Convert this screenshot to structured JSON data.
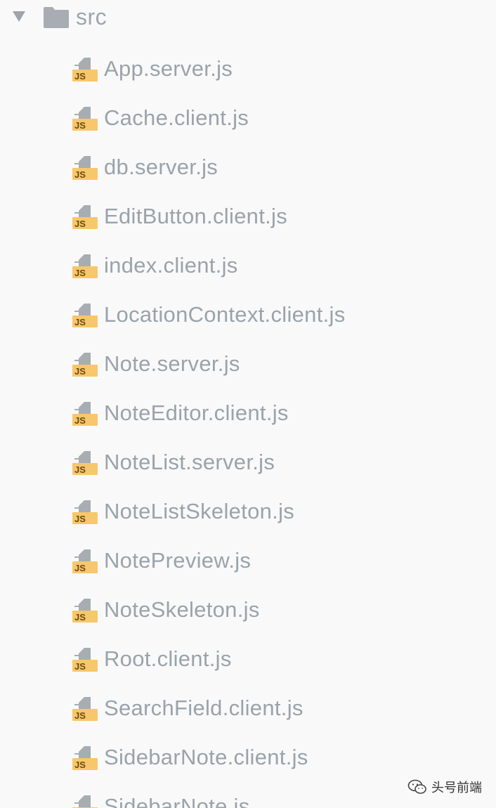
{
  "folder": {
    "name": "src",
    "expanded": true,
    "icon": "folder-icon"
  },
  "files": [
    {
      "name": "App.server.js",
      "icon": "js-file-icon"
    },
    {
      "name": "Cache.client.js",
      "icon": "js-file-icon"
    },
    {
      "name": "db.server.js",
      "icon": "js-file-icon"
    },
    {
      "name": "EditButton.client.js",
      "icon": "js-file-icon"
    },
    {
      "name": "index.client.js",
      "icon": "js-file-icon"
    },
    {
      "name": "LocationContext.client.js",
      "icon": "js-file-icon"
    },
    {
      "name": "Note.server.js",
      "icon": "js-file-icon"
    },
    {
      "name": "NoteEditor.client.js",
      "icon": "js-file-icon"
    },
    {
      "name": "NoteList.server.js",
      "icon": "js-file-icon"
    },
    {
      "name": "NoteListSkeleton.js",
      "icon": "js-file-icon"
    },
    {
      "name": "NotePreview.js",
      "icon": "js-file-icon"
    },
    {
      "name": "NoteSkeleton.js",
      "icon": "js-file-icon"
    },
    {
      "name": "Root.client.js",
      "icon": "js-file-icon"
    },
    {
      "name": "SearchField.client.js",
      "icon": "js-file-icon"
    },
    {
      "name": "SidebarNote.client.js",
      "icon": "js-file-icon"
    },
    {
      "name": "SidebarNote.js",
      "icon": "js-file-icon"
    }
  ],
  "js_badge_text": "JS",
  "watermark": {
    "text": "头号前端",
    "icon": "wechat-icon"
  },
  "colors": {
    "background": "#f9f9f9",
    "text": "#9aa3ab",
    "icon_gray": "#a7adb2",
    "js_badge": "#f7c76b",
    "js_text": "#6b4b12"
  }
}
